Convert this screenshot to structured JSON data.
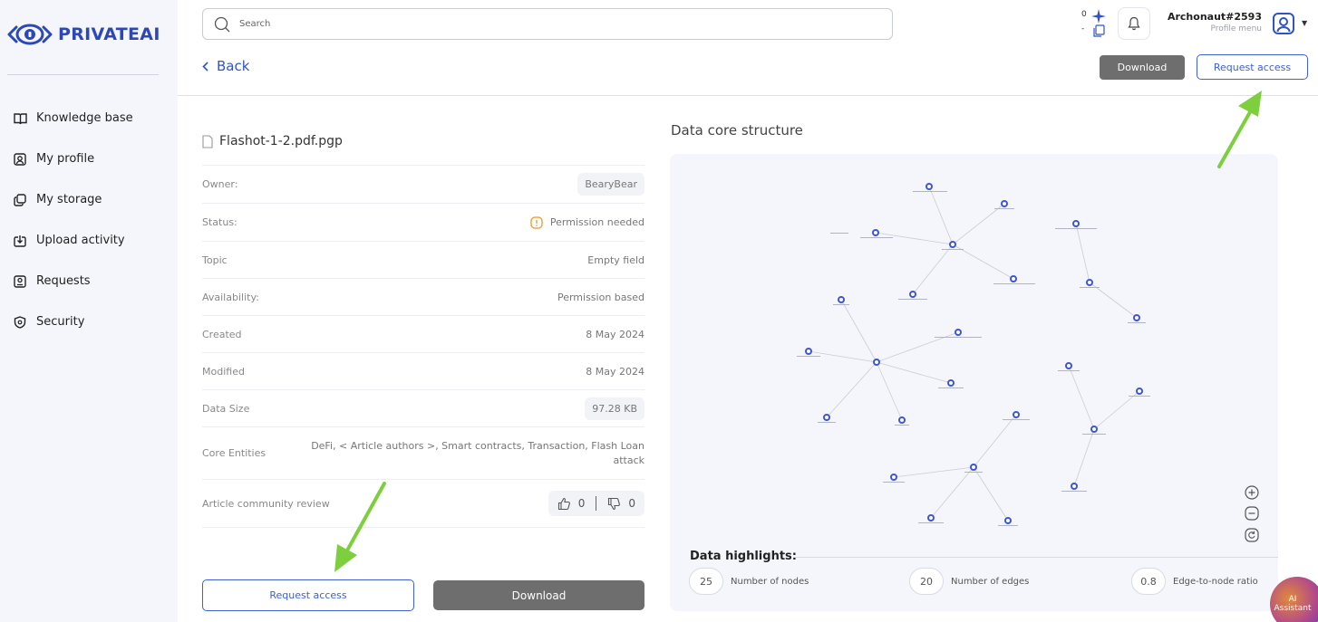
{
  "app": {
    "logo_text": "PRIVATEAI"
  },
  "sidebar": {
    "items": [
      {
        "label": "Knowledge base",
        "icon": "book-icon"
      },
      {
        "label": "My profile",
        "icon": "profile-icon"
      },
      {
        "label": "My storage",
        "icon": "storage-icon"
      },
      {
        "label": "Upload activity",
        "icon": "upload-icon"
      },
      {
        "label": "Requests",
        "icon": "requests-icon"
      },
      {
        "label": "Security",
        "icon": "shield-icon"
      }
    ]
  },
  "header": {
    "search_placeholder": "Search",
    "counter_top": "0",
    "counter_bottom": "-",
    "username": "Archonaut#2593",
    "profile_menu": "Profile menu"
  },
  "toolbar": {
    "back_label": "Back",
    "download_label": "Download",
    "request_access_label": "Request access"
  },
  "file": {
    "name": "Flashot-1-2.pdf.pgp",
    "rows": [
      {
        "key": "Owner:",
        "value": "BearyBear",
        "style": "pill"
      },
      {
        "key": "Status:",
        "value": "Permission needed",
        "style": "warn"
      },
      {
        "key": "Topic",
        "value": "Empty field",
        "style": "plain"
      },
      {
        "key": "Availability:",
        "value": "Permission based",
        "style": "plain"
      },
      {
        "key": "Created",
        "value": "8 May 2024",
        "style": "plain"
      },
      {
        "key": "Modified",
        "value": "8 May 2024",
        "style": "plain"
      },
      {
        "key": "Data Size",
        "value": "97.28 KB",
        "style": "pill"
      },
      {
        "key": "Core Entities",
        "value": "DeFi, < Article authors >, Smart contracts, Transaction, Flash Loan attack",
        "style": "plain"
      },
      {
        "key": "Article community review",
        "value": "",
        "style": "vote"
      }
    ],
    "likes": "0",
    "dislikes": "0",
    "request_access_label": "Request access",
    "download_label": "Download"
  },
  "graph": {
    "title": "Data core structure",
    "highlights_title": "Data highlights:",
    "stats": [
      {
        "value": "25",
        "label": "Number of nodes"
      },
      {
        "value": "20",
        "label": "Number of edges"
      },
      {
        "value": "0.8",
        "label": "Edge-to-node ratio"
      }
    ]
  },
  "ai_assistant": {
    "line1": "AI",
    "line2": "Assistant"
  },
  "colors": {
    "brand": "#2c47b8",
    "link": "#2f53c8",
    "warning": "#e89b2a",
    "annotation_arrow": "#7dcf3e"
  }
}
